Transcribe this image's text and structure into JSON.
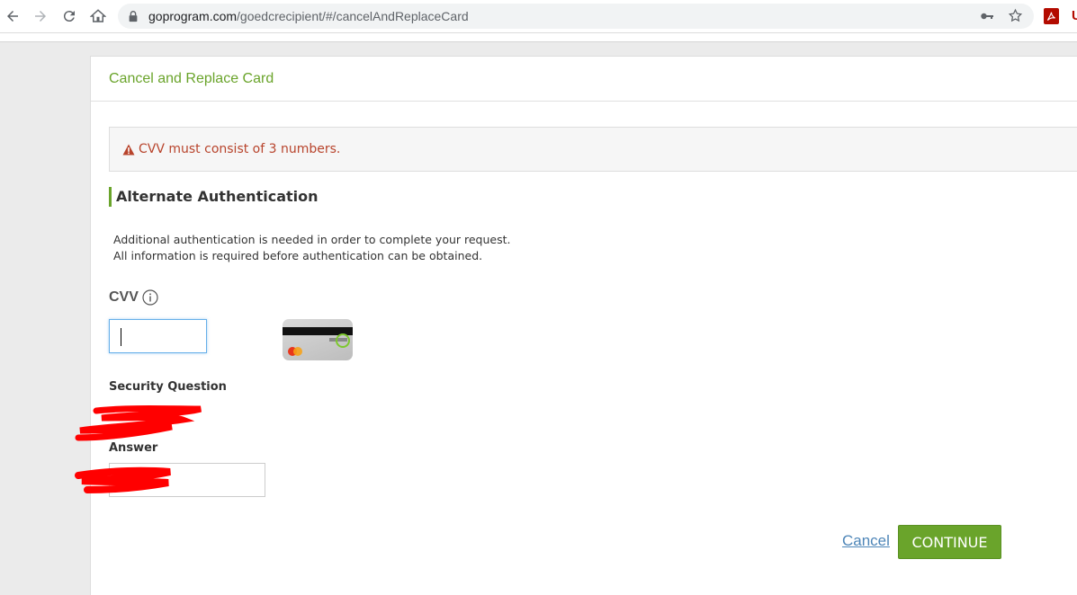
{
  "browser": {
    "url_host": "goprogram.com",
    "url_path": "/goedcrecipient/#/cancelAndReplaceCard",
    "icons": [
      "back-icon",
      "forward-icon",
      "reload-icon",
      "home-icon",
      "lock-icon",
      "key-icon",
      "star-icon",
      "pdf-extension-icon"
    ]
  },
  "page": {
    "header_title": "Cancel and Replace Card",
    "alert_message": "CVV must consist of 3 numbers.",
    "section_title": "Alternate Authentication",
    "description_line1": "Additional authentication is needed in order to complete your request.",
    "description_line2": "All information is required before authentication can be obtained.",
    "cvv_label": "CVV",
    "cvv_value": "",
    "security_question_label": "Security Question",
    "answer_label": "Answer",
    "cancel_label": "Cancel",
    "continue_label": "CONTINUE"
  },
  "colors": {
    "accent_green": "#6aa42b",
    "error_red": "#b8442c",
    "link_blue": "#4e86b8"
  }
}
